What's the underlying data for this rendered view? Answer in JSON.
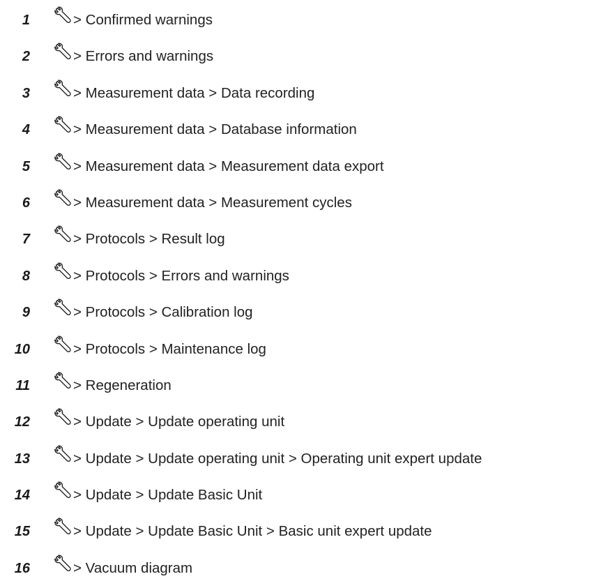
{
  "menu_paths": {
    "icon": "wrench-icon",
    "items": [
      {
        "number": "1",
        "path": "> Confirmed warnings"
      },
      {
        "number": "2",
        "path": "> Errors and warnings"
      },
      {
        "number": "3",
        "path": "> Measurement data > Data recording"
      },
      {
        "number": "4",
        "path": "> Measurement data > Database information"
      },
      {
        "number": "5",
        "path": "> Measurement data > Measurement data export"
      },
      {
        "number": "6",
        "path": "> Measurement data > Measurement cycles"
      },
      {
        "number": "7",
        "path": "> Protocols > Result log"
      },
      {
        "number": "8",
        "path": "> Protocols > Errors and warnings"
      },
      {
        "number": "9",
        "path": "> Protocols > Calibration log"
      },
      {
        "number": "10",
        "path": "> Protocols > Maintenance log"
      },
      {
        "number": "11",
        "path": "> Regeneration"
      },
      {
        "number": "12",
        "path": "> Update > Update operating unit"
      },
      {
        "number": "13",
        "path": "> Update > Update operating unit > Operating unit expert update"
      },
      {
        "number": "14",
        "path": "> Update > Update Basic Unit"
      },
      {
        "number": "15",
        "path": "> Update > Update Basic Unit > Basic unit expert update"
      },
      {
        "number": "16",
        "path": "> Vacuum diagram"
      }
    ]
  }
}
